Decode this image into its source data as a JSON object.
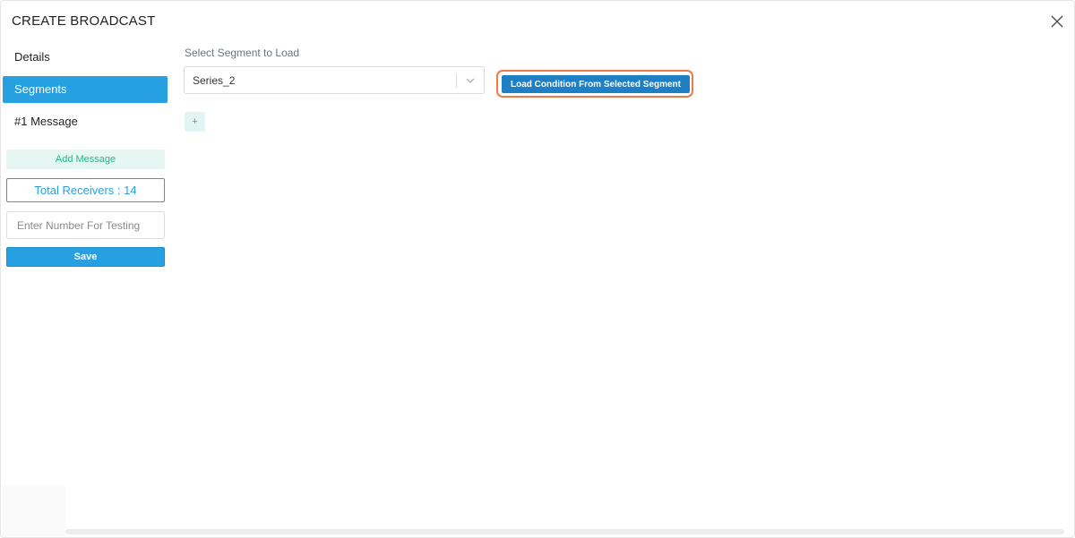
{
  "modal": {
    "title": "CREATE BROADCAST",
    "close_icon": "close-icon"
  },
  "sidebar": {
    "items": [
      {
        "label": "Details",
        "active": false
      },
      {
        "label": "Segments",
        "active": true
      },
      {
        "label": "#1 Message",
        "active": false
      }
    ],
    "add_message_label": "Add Message",
    "total_receivers_text": "Total Receivers : 14",
    "test_number_placeholder": "Enter Number For Testing",
    "save_label": "Save"
  },
  "main": {
    "segment_label": "Select Segment to Load",
    "segment_selected": "Series_2",
    "load_button_label": "Load Condition From Selected Segment",
    "add_condition_label": "+"
  },
  "colors": {
    "accent": "#27a0e2",
    "load_button": "#1d7fc4",
    "highlight_outline": "#f0784a",
    "success_text": "#2bb48a",
    "success_bg": "#e6f6f3"
  }
}
